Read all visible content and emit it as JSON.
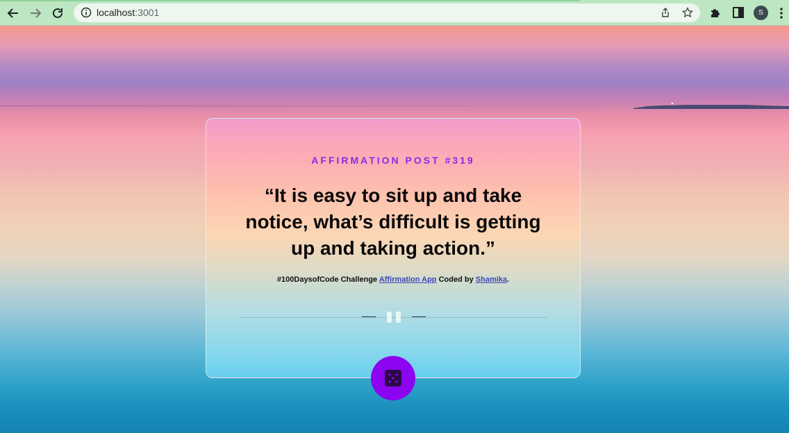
{
  "browser": {
    "url_host": "localhost",
    "url_port": ":3001",
    "profile_initial": "S"
  },
  "post": {
    "eyebrow": "AFFIRMATION POST #319",
    "quote": "“It is easy to sit up and take notice, what’s difficult is getting up and taking action.”",
    "credit_prefix": "#100DaysofCode Challenge ",
    "app_link": "Affirmation App",
    "credit_middle": " Coded by ",
    "author_link": "Shamika",
    "credit_suffix": "."
  },
  "colors": {
    "accent": "#8b2be2",
    "button": "#8d04f0",
    "link": "#3b47b8"
  },
  "icons": {
    "back": "arrow-left-icon",
    "forward": "arrow-right-icon",
    "reload": "reload-icon",
    "dice": "dice-icon"
  }
}
